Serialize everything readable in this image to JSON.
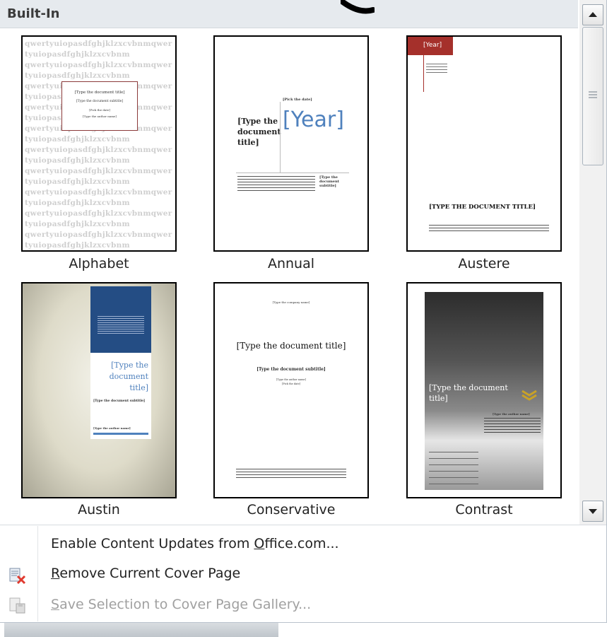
{
  "gallery": {
    "header": "Built-In",
    "items": [
      {
        "label": "Alphabet"
      },
      {
        "label": "Annual"
      },
      {
        "label": "Austere"
      },
      {
        "label": "Austin"
      },
      {
        "label": "Conservative"
      },
      {
        "label": "Contrast"
      }
    ]
  },
  "thumbs": {
    "alphabet": {
      "title": "[Type the document title]",
      "subtitle": "[Type the document subtitle]",
      "author": "[Pick the date]",
      "company": "[Type the author name]",
      "pattern": "qwertyuiopasdfghjklzxcvbnmqwertyuiopasdfghjklzxcvbnm"
    },
    "annual": {
      "date": "[Pick the date]",
      "title": "[Type the document title]",
      "year": "[Year]",
      "sub": "[Type the document subtitle]"
    },
    "austere": {
      "year": "[Year]",
      "title": "[TYPE THE DOCUMENT TITLE]"
    },
    "austin": {
      "title": "[Type the document title]",
      "sub": "[Type the document subtitle]",
      "author": "[Type the author name]"
    },
    "conservative": {
      "top": "[Type the company name]",
      "title": "[Type the document title]",
      "sub": "[Type the document subtitle]",
      "author": "[Type the author name]",
      "date": "[Pick the date]"
    },
    "contrast": {
      "title": "[Type the document title]",
      "sub": "[Type the author name]"
    }
  },
  "menu": {
    "item1": {
      "pre": "Enable Content Updates from ",
      "ul": "O",
      "post": "ffice.com..."
    },
    "item2": {
      "ul": "R",
      "post": "emove Current Cover Page"
    },
    "item3": {
      "ul": "S",
      "post": "ave Selection to Cover Page Gallery..."
    }
  },
  "colors": {
    "header_bg": "#e6eaee",
    "accent_blue": "#4f81bd",
    "austere_red": "#a5302b",
    "austin_blue": "#244d84"
  },
  "icons": [
    "scroll-up-icon",
    "scroll-down-icon",
    "remove-cover-icon",
    "save-cover-icon"
  ]
}
